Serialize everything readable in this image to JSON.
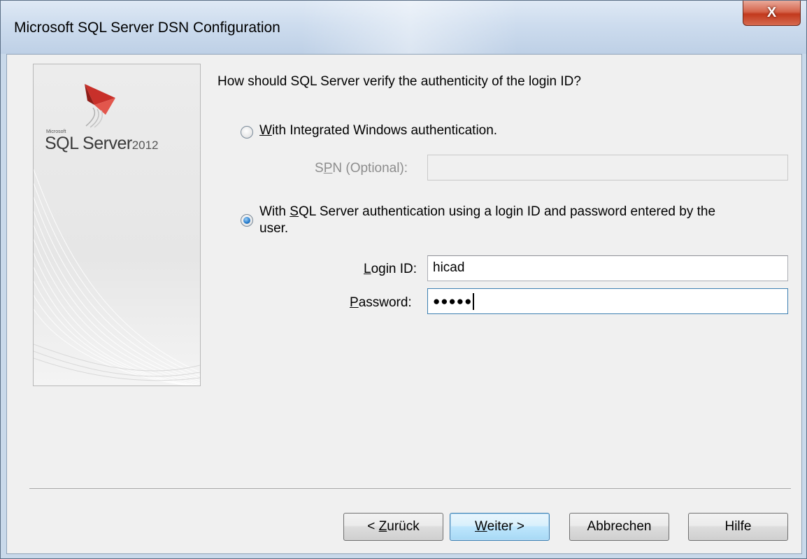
{
  "window": {
    "title": "Microsoft SQL Server DSN Configuration",
    "close_glyph": "X"
  },
  "banner": {
    "brand_small": "Microsoft",
    "product": "SQL Server",
    "year": "2012",
    "logo_icon": "sql-server-logo-icon"
  },
  "auth": {
    "question": "How should SQL Server verify the authenticity of the login ID?",
    "options": [
      {
        "label_pre": "",
        "mnemonic": "W",
        "label_post": "ith Integrated Windows authentication.",
        "checked": false
      },
      {
        "label_pre": "With ",
        "mnemonic": "S",
        "label_post": "QL Server authentication using a login ID and password entered by the",
        "label_line2": "user.",
        "checked": true
      }
    ],
    "spn": {
      "label_pre": "S",
      "mnemonic": "P",
      "label_post": "N (Optional):",
      "value": "",
      "enabled": false
    },
    "login": {
      "label_pre": "",
      "mnemonic": "L",
      "label_post": "ogin ID:",
      "value": "hicad"
    },
    "password": {
      "label_pre": "",
      "mnemonic": "P",
      "label_post": "assword:",
      "value": "●●●●●"
    }
  },
  "buttons": {
    "back": {
      "prefix": "< ",
      "mnemonic": "Z",
      "rest": "urück"
    },
    "next": {
      "prefix": "",
      "mnemonic": "W",
      "rest": "eiter >"
    },
    "cancel": {
      "label": "Abbrechen"
    },
    "help": {
      "label": "Hilfe"
    }
  },
  "colors": {
    "client_bg": "#f0f0f0",
    "titlebar": "#cddcee",
    "close_red": "#c2391d",
    "radio_selected": "#2a7fcf"
  }
}
